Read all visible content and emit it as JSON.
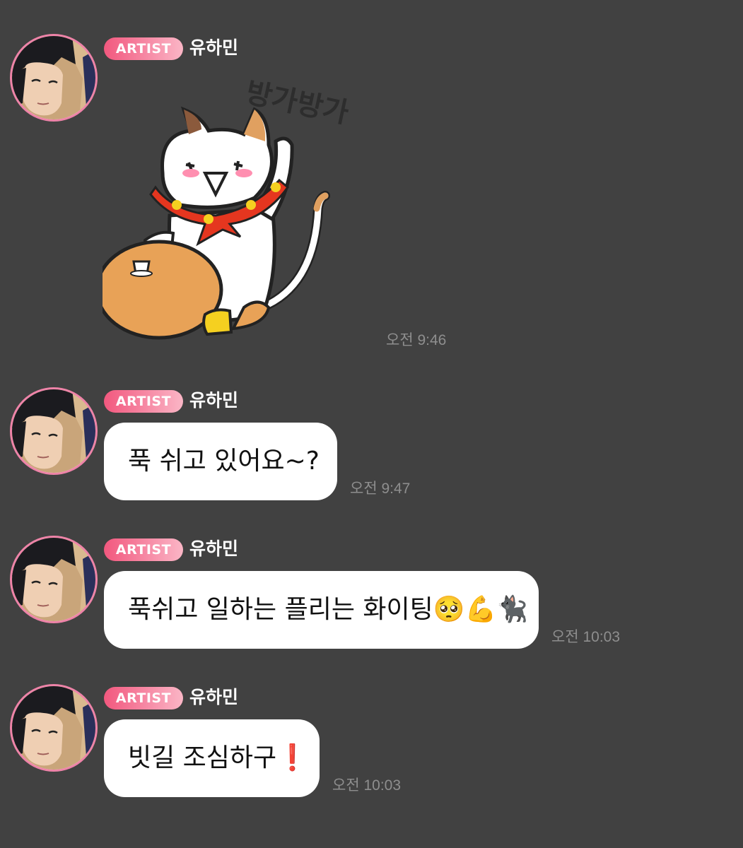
{
  "messages": [
    {
      "badge": "ARTIST",
      "sender": "유하민",
      "type": "sticker",
      "sticker": {
        "caption": "방가방가",
        "icon": "waving-cat-sticker"
      },
      "time": "오전 9:46"
    },
    {
      "badge": "ARTIST",
      "sender": "유하민",
      "type": "text",
      "text": "푹 쉬고 있어요~?",
      "time": "오전 9:47"
    },
    {
      "badge": "ARTIST",
      "sender": "유하민",
      "type": "text",
      "text": "푹쉬고 일하는 플리는 화이팅🥺💪🐈‍⬛",
      "time": "오전 10:03"
    },
    {
      "badge": "ARTIST",
      "sender": "유하민",
      "type": "text",
      "text": "빗길 조심하구❗",
      "time": "오전 10:03"
    }
  ],
  "colors": {
    "background": "#414141",
    "badge": "#f2587e",
    "avatar_ring": "#ee83a8",
    "bubble": "#ffffff",
    "timestamp": "#8e8e8e"
  }
}
